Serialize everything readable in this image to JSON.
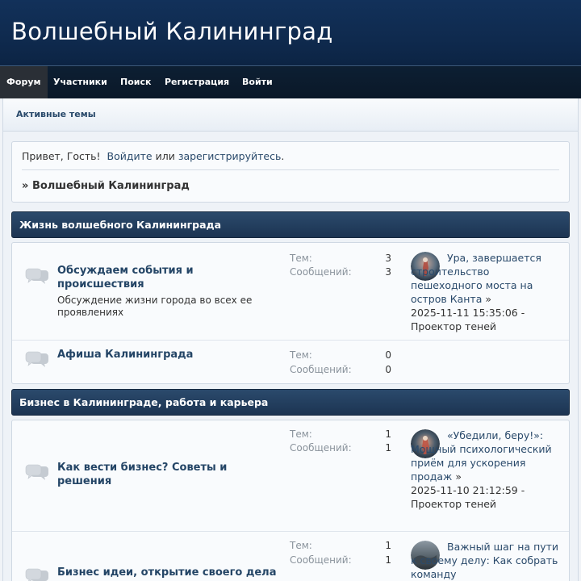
{
  "site": {
    "title": "Волшебный Калининград"
  },
  "nav": [
    {
      "label": "Форум",
      "active": true
    },
    {
      "label": "Участники"
    },
    {
      "label": "Поиск"
    },
    {
      "label": "Регистрация"
    },
    {
      "label": "Войти"
    }
  ],
  "subnav": {
    "active_topics": "Активные темы"
  },
  "welcome": {
    "greeting": "Привет, Гость!",
    "login_link": "Войдите",
    "or": "или",
    "register_link": "зарегистрируйтесь",
    "period": "."
  },
  "breadcrumb": {
    "arrow": "»",
    "label": "Волшебный Калининград"
  },
  "categories": [
    {
      "title": "Жизнь волшебного Калининграда",
      "boards": [
        {
          "name": "Обсуждаем события и происшествия",
          "description": "Обсуждение жизни города во всех ее проявлениях",
          "topics_label": "Тем:",
          "topics": "3",
          "posts_label": "Сообщений:",
          "posts": "3",
          "last_post": {
            "topic": "Ура, завершается строительство пешеходного моста на остров Канта",
            "arrow": "»",
            "date": "2025-11-11 15:35:06",
            "dash": "-",
            "author": "Проектор теней"
          }
        },
        {
          "name": "Афиша Калининграда",
          "description": "",
          "topics_label": "Тем:",
          "topics": "0",
          "posts_label": "Сообщений:",
          "posts": "0"
        }
      ]
    },
    {
      "title": "Бизнес в Калининграде, работа и карьера",
      "boards": [
        {
          "name": "Как вести бизнес? Советы и решения",
          "description": "",
          "topics_label": "Тем:",
          "topics": "1",
          "posts_label": "Сообщений:",
          "posts": "1",
          "last_post": {
            "topic": "«Убедили, беру!»: Мощный психологический приём для ускорения продаж",
            "arrow": "»",
            "date": "2025-11-10 21:12:59",
            "dash": "-",
            "author": "Проектор теней"
          }
        },
        {
          "name": "Бизнес идеи, открытие своего дела",
          "description": "",
          "topics_label": "Тем:",
          "topics": "1",
          "posts_label": "Сообщений:",
          "posts": "1",
          "last_post": {
            "topic": "Важный шаг на пути к своему делу: Как собрать команду"
          }
        }
      ]
    }
  ],
  "colors": {
    "header_bg": "#12315a",
    "nav_bg": "#0d1f33",
    "category_bg": "#2b4a6c",
    "link": "#2a4a6b"
  },
  "icons": {
    "board": "speech-bubbles-icon"
  }
}
